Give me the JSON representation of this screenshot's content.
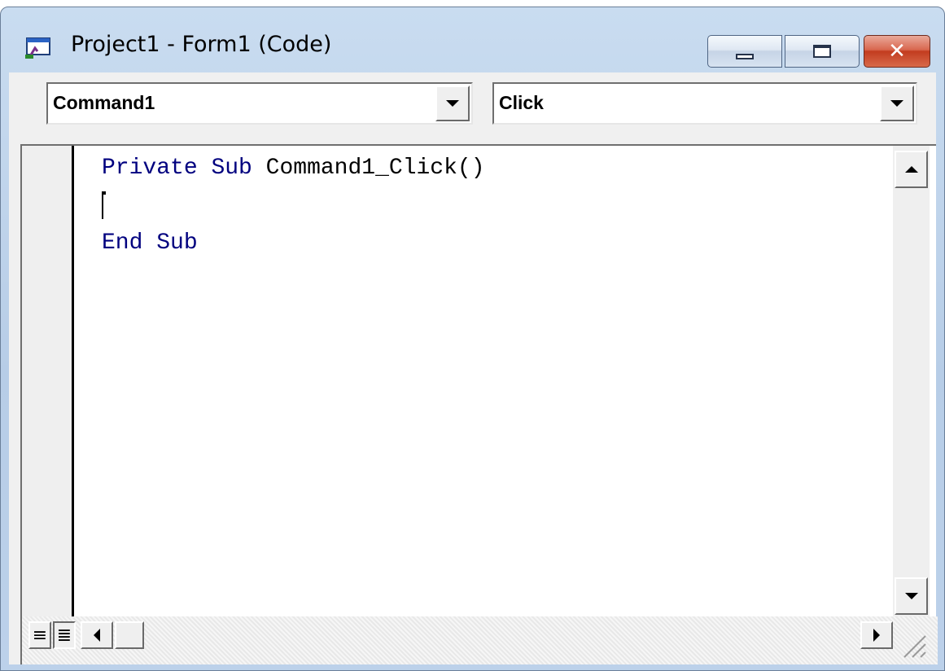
{
  "window": {
    "title": "Project1 - Form1 (Code)",
    "icon": "code-window-icon",
    "controls": {
      "minimize": "minimize-icon",
      "maximize": "maximize-icon",
      "close": "close-icon",
      "close_glyph": "✕"
    }
  },
  "toolbar": {
    "object_combo": {
      "value": "Command1"
    },
    "procedure_combo": {
      "value": "Click"
    }
  },
  "code": {
    "line1": {
      "kw1": "Private",
      "kw2": "Sub",
      "name": "Command1_Click()"
    },
    "line3": {
      "kw1": "End",
      "kw2": "Sub"
    }
  },
  "view_buttons": {
    "procedure_view": "≡",
    "full_module_view": "≣"
  },
  "colors": {
    "keyword": "#00007f",
    "text": "#000000",
    "title_bar": "#c9dcf0",
    "close_button": "#c23c1f"
  }
}
